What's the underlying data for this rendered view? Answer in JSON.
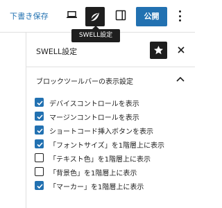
{
  "toolbar": {
    "draft_label": "下書き保存",
    "publish_label": "公開",
    "tooltip": "SWELL設定",
    "icons": [
      "desktop-icon",
      "swell-logo-icon",
      "sidebar-toggle-icon",
      "more-vertical-icon"
    ]
  },
  "panel": {
    "title": "SWELL設定",
    "icons": [
      "star-icon",
      "close-icon"
    ]
  },
  "section": {
    "title": "ブロックツールバーの表示設定",
    "expanded": true,
    "options": [
      {
        "label": "デバイスコントロールを表示",
        "checked": true
      },
      {
        "label": "マージンコントロールを表示",
        "checked": true
      },
      {
        "label": "ショートコード挿入ボタンを表示",
        "checked": true
      },
      {
        "label": "「フォントサイズ」を1階層上に表示",
        "checked": true
      },
      {
        "label": "「テキスト色」を1階層上に表示",
        "checked": false
      },
      {
        "label": "「背景色」を1階層上に表示",
        "checked": false
      },
      {
        "label": "「マーカー」を1階層上に表示",
        "checked": true
      }
    ]
  },
  "colors": {
    "accent": "#2271b1",
    "dark": "#1e1e1e",
    "border": "#e0e0e0"
  }
}
